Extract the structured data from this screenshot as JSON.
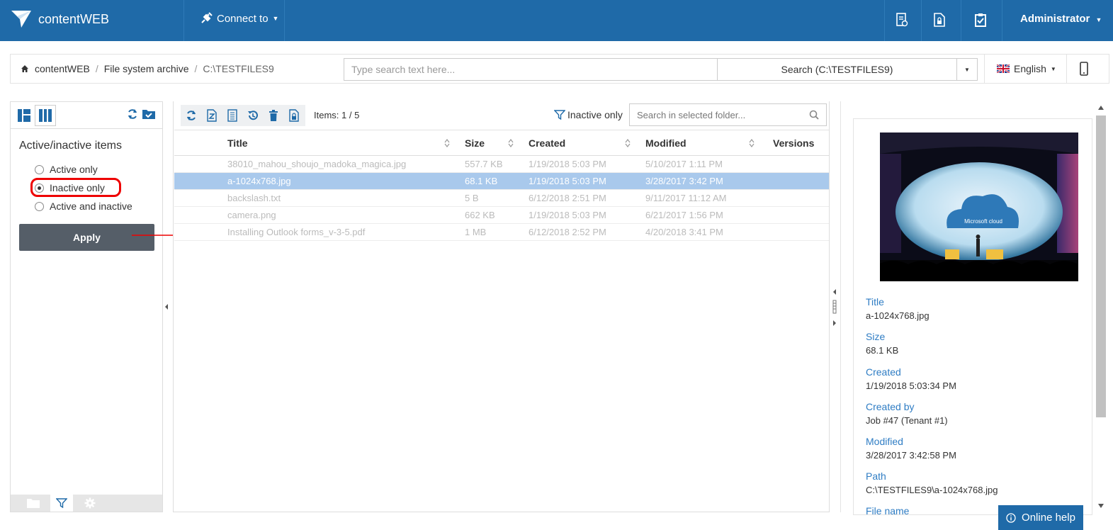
{
  "app": {
    "name": "contentWEB",
    "connect_label": "Connect to",
    "user": "Administrator"
  },
  "breadcrumb": {
    "home": "contentWEB",
    "archive": "File system archive",
    "folder": "C:\\TESTFILES9"
  },
  "search": {
    "placeholder": "Type search text here...",
    "button_label": "Search (C:\\TESTFILES9)"
  },
  "language": "English",
  "left_panel": {
    "title": "Active/inactive items",
    "options": [
      "Active only",
      "Inactive only",
      "Active and inactive"
    ],
    "selected_option": "Inactive only",
    "apply_label": "Apply"
  },
  "toolbar": {
    "items_count": "Items: 1 / 5",
    "filter_indicator": "Inactive only",
    "folder_search_placeholder": "Search in selected folder..."
  },
  "grid": {
    "columns": [
      "Title",
      "Size",
      "Created",
      "Modified",
      "Versions"
    ],
    "rows": [
      {
        "title": "38010_mahou_shoujo_madoka_magica.jpg",
        "size": "557.7 KB",
        "created": "1/19/2018 5:03 PM",
        "modified": "5/10/2017 1:11 PM",
        "versions": ""
      },
      {
        "title": "a-1024x768.jpg",
        "size": "68.1 KB",
        "created": "1/19/2018 5:03 PM",
        "modified": "3/28/2017 3:42 PM",
        "versions": ""
      },
      {
        "title": "backslash.txt",
        "size": "5 B",
        "created": "6/12/2018 2:51 PM",
        "modified": "9/11/2017 11:12 AM",
        "versions": ""
      },
      {
        "title": "camera.png",
        "size": "662 KB",
        "created": "1/19/2018 5:03 PM",
        "modified": "6/21/2017 1:56 PM",
        "versions": ""
      },
      {
        "title": "Installing Outlook forms_v-3-5.pdf",
        "size": "1 MB",
        "created": "6/12/2018 2:52 PM",
        "modified": "4/20/2018 3:41 PM",
        "versions": ""
      }
    ],
    "selected_index": 1
  },
  "preview": {
    "slide_text": "Microsoft cloud"
  },
  "properties": [
    {
      "label": "Title",
      "value": "a-1024x768.jpg"
    },
    {
      "label": "Size",
      "value": "68.1 KB"
    },
    {
      "label": "Created",
      "value": "1/19/2018 5:03:34 PM"
    },
    {
      "label": "Created by",
      "value": "Job #47 (Tenant #1)"
    },
    {
      "label": "Modified",
      "value": "3/28/2017 3:42:58 PM"
    },
    {
      "label": "Path",
      "value": "C:\\TESTFILES9\\a-1024x768.jpg"
    },
    {
      "label": "File name",
      "value": ""
    }
  ],
  "online_help": "Online help",
  "colors": {
    "topbar": "#1f6aa8",
    "selected_row": "#a9c9ec",
    "link_blue": "#2f7dc4",
    "apply_button": "#555e68",
    "highlight_red": "#e00000"
  }
}
